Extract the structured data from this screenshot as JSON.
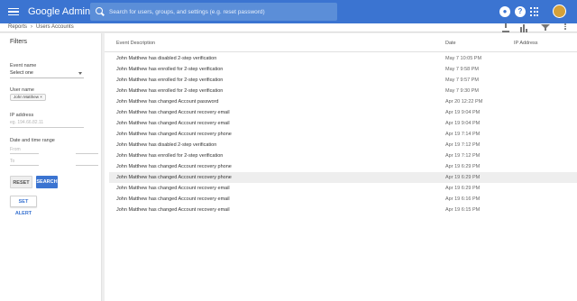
{
  "app": {
    "title": "Google Admin"
  },
  "search": {
    "placeholder": "Search for users, groups, and settings (e.g. reset password)"
  },
  "topbar_icons": [
    "menu-icon",
    "search-icon",
    "account-circle-icon",
    "help-icon",
    "apps-grid-icon",
    "avatar"
  ],
  "breadcrumb": {
    "items": [
      "Reports",
      "Users Accounts"
    ]
  },
  "filters": {
    "title": "Filters",
    "event_name": {
      "label": "Event name",
      "value": "Select one"
    },
    "user_name": {
      "label": "User name",
      "chip": "John Matthew"
    },
    "ip_address": {
      "label": "IP address",
      "placeholder": "eg. 194.66.82.11"
    },
    "date_range": {
      "label": "Date and time range",
      "from_placeholder": "From",
      "to_placeholder": "To"
    },
    "reset_label": "RESET",
    "search_label": "SEARCH",
    "set_alert_label": "SET ALERT"
  },
  "toolbar_icons": [
    "download-icon",
    "columns-icon",
    "filter-icon",
    "more-vert-icon"
  ],
  "table": {
    "headers": [
      "Event Description",
      "Date",
      "IP Address"
    ],
    "rows": [
      {
        "description": "John Matthew has disabled 2-step verification",
        "date": "May 7 10:05 PM"
      },
      {
        "description": "John Matthew has enrolled for 2-step verification",
        "date": "May 7 9:58 PM"
      },
      {
        "description": "John Matthew has enrolled for 2-step verification",
        "date": "May 7 9:57 PM"
      },
      {
        "description": "John Matthew has enrolled for 2-step verification",
        "date": "May 7 9:30 PM"
      },
      {
        "description": "John Matthew has changed Account password",
        "date": "Apr 20 12:22 PM"
      },
      {
        "description": "John Matthew has changed Account recovery email",
        "date": "Apr 19 9:04 PM"
      },
      {
        "description": "John Matthew has changed Account recovery email",
        "date": "Apr 19 9:04 PM"
      },
      {
        "description": "John Matthew has changed Account recovery phone",
        "date": "Apr 19 7:14 PM"
      },
      {
        "description": "John Matthew has disabled 2-step verification",
        "date": "Apr 19 7:12 PM"
      },
      {
        "description": "John Matthew has enrolled for 2-step verification",
        "date": "Apr 19 7:12 PM"
      },
      {
        "description": "John Matthew has changed Account recovery phone",
        "date": "Apr 19 6:29 PM"
      },
      {
        "description": "John Matthew has changed Account recovery phone",
        "date": "Apr 19 6:29 PM"
      },
      {
        "description": "John Matthew has changed Account recovery email",
        "date": "Apr 19 6:29 PM"
      },
      {
        "description": "John Matthew has changed Account recovery email",
        "date": "Apr 19 6:16 PM"
      },
      {
        "description": "John Matthew has changed Account recovery email",
        "date": "Apr 19 6:15 PM"
      }
    ],
    "highlighted_row": 11
  },
  "colors": {
    "brand": "#3b74d1",
    "background": "#eeeeee",
    "highlight_row": "#eeeeee"
  }
}
